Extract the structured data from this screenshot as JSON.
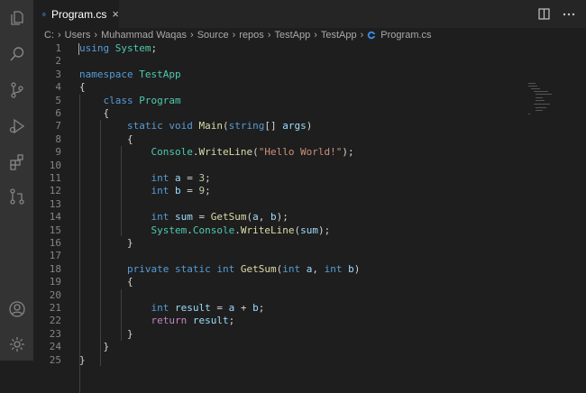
{
  "tab": {
    "title": "Program.cs",
    "close_icon": "×"
  },
  "breadcrumb": [
    {
      "label": "C:"
    },
    {
      "label": "Users"
    },
    {
      "label": "Muhammad Waqas"
    },
    {
      "label": "Source"
    },
    {
      "label": "repos"
    },
    {
      "label": "TestApp"
    },
    {
      "label": "TestApp"
    },
    {
      "label": "Program.cs"
    }
  ],
  "colors": {
    "background": "#1e1e1e",
    "activity_bar": "#333333",
    "keyword": "#569cd6",
    "control_keyword": "#c586c0",
    "type": "#4ec9b0",
    "function": "#dcdcaa",
    "variable": "#9cdcfe",
    "string": "#ce9178",
    "number": "#b5cea8",
    "line_number": "#858585",
    "csharp_icon": "#388adf"
  },
  "activity_bar": [
    "files-icon",
    "search-icon",
    "source-control-icon",
    "run-debug-icon",
    "extensions-icon",
    "pull-requests-icon",
    "account-icon",
    "settings-gear-icon"
  ],
  "editor": {
    "lines": [
      {
        "n": "1",
        "tokens": [
          [
            "k",
            "using"
          ],
          [
            "p",
            " "
          ],
          [
            "t",
            "System"
          ],
          [
            "p",
            ";"
          ]
        ]
      },
      {
        "n": "2",
        "tokens": []
      },
      {
        "n": "3",
        "tokens": [
          [
            "k",
            "namespace"
          ],
          [
            "p",
            " "
          ],
          [
            "t",
            "TestApp"
          ]
        ]
      },
      {
        "n": "4",
        "tokens": [
          [
            "p",
            "{"
          ]
        ]
      },
      {
        "n": "5",
        "tokens": [
          [
            "p",
            "    "
          ],
          [
            "k",
            "class"
          ],
          [
            "p",
            " "
          ],
          [
            "t",
            "Program"
          ]
        ]
      },
      {
        "n": "6",
        "tokens": [
          [
            "p",
            "    {"
          ]
        ]
      },
      {
        "n": "7",
        "tokens": [
          [
            "p",
            "        "
          ],
          [
            "k",
            "static"
          ],
          [
            "p",
            " "
          ],
          [
            "k",
            "void"
          ],
          [
            "p",
            " "
          ],
          [
            "f",
            "Main"
          ],
          [
            "p",
            "("
          ],
          [
            "k",
            "string"
          ],
          [
            "p",
            "[] "
          ],
          [
            "v",
            "args"
          ],
          [
            "p",
            ")"
          ]
        ]
      },
      {
        "n": "8",
        "tokens": [
          [
            "p",
            "        {"
          ]
        ]
      },
      {
        "n": "9",
        "tokens": [
          [
            "p",
            "            "
          ],
          [
            "t",
            "Console"
          ],
          [
            "p",
            "."
          ],
          [
            "f",
            "WriteLine"
          ],
          [
            "p",
            "("
          ],
          [
            "s",
            "\"Hello World!\""
          ],
          [
            "p",
            ");"
          ]
        ]
      },
      {
        "n": "10",
        "tokens": []
      },
      {
        "n": "11",
        "tokens": [
          [
            "p",
            "            "
          ],
          [
            "k",
            "int"
          ],
          [
            "p",
            " "
          ],
          [
            "v",
            "a"
          ],
          [
            "p",
            " = "
          ],
          [
            "n",
            "3"
          ],
          [
            "p",
            ";"
          ]
        ]
      },
      {
        "n": "12",
        "tokens": [
          [
            "p",
            "            "
          ],
          [
            "k",
            "int"
          ],
          [
            "p",
            " "
          ],
          [
            "v",
            "b"
          ],
          [
            "p",
            " = "
          ],
          [
            "n",
            "9"
          ],
          [
            "p",
            ";"
          ]
        ]
      },
      {
        "n": "13",
        "tokens": []
      },
      {
        "n": "14",
        "tokens": [
          [
            "p",
            "            "
          ],
          [
            "k",
            "int"
          ],
          [
            "p",
            " "
          ],
          [
            "v",
            "sum"
          ],
          [
            "p",
            " = "
          ],
          [
            "f",
            "GetSum"
          ],
          [
            "p",
            "("
          ],
          [
            "v",
            "a"
          ],
          [
            "p",
            ", "
          ],
          [
            "v",
            "b"
          ],
          [
            "p",
            ");"
          ]
        ]
      },
      {
        "n": "15",
        "tokens": [
          [
            "p",
            "            "
          ],
          [
            "t",
            "System"
          ],
          [
            "p",
            "."
          ],
          [
            "t",
            "Console"
          ],
          [
            "p",
            "."
          ],
          [
            "f",
            "WriteLine"
          ],
          [
            "p",
            "("
          ],
          [
            "v",
            "sum"
          ],
          [
            "p",
            ");"
          ]
        ]
      },
      {
        "n": "16",
        "tokens": [
          [
            "p",
            "        }"
          ]
        ]
      },
      {
        "n": "17",
        "tokens": []
      },
      {
        "n": "18",
        "tokens": [
          [
            "p",
            "        "
          ],
          [
            "k",
            "private"
          ],
          [
            "p",
            " "
          ],
          [
            "k",
            "static"
          ],
          [
            "p",
            " "
          ],
          [
            "k",
            "int"
          ],
          [
            "p",
            " "
          ],
          [
            "f",
            "GetSum"
          ],
          [
            "p",
            "("
          ],
          [
            "k",
            "int"
          ],
          [
            "p",
            " "
          ],
          [
            "v",
            "a"
          ],
          [
            "p",
            ", "
          ],
          [
            "k",
            "int"
          ],
          [
            "p",
            " "
          ],
          [
            "v",
            "b"
          ],
          [
            "p",
            ")"
          ]
        ]
      },
      {
        "n": "19",
        "tokens": [
          [
            "p",
            "        {"
          ]
        ]
      },
      {
        "n": "20",
        "tokens": []
      },
      {
        "n": "21",
        "tokens": [
          [
            "p",
            "            "
          ],
          [
            "k",
            "int"
          ],
          [
            "p",
            " "
          ],
          [
            "v",
            "result"
          ],
          [
            "p",
            " = "
          ],
          [
            "v",
            "a"
          ],
          [
            "p",
            " + "
          ],
          [
            "v",
            "b"
          ],
          [
            "p",
            ";"
          ]
        ]
      },
      {
        "n": "22",
        "tokens": [
          [
            "p",
            "            "
          ],
          [
            "kc",
            "return"
          ],
          [
            "p",
            " "
          ],
          [
            "v",
            "result"
          ],
          [
            "p",
            ";"
          ]
        ]
      },
      {
        "n": "23",
        "tokens": [
          [
            "p",
            "        }"
          ]
        ]
      },
      {
        "n": "24",
        "tokens": [
          [
            "p",
            "    }"
          ]
        ]
      },
      {
        "n": "25",
        "tokens": [
          [
            "p",
            "}"
          ]
        ]
      }
    ]
  }
}
